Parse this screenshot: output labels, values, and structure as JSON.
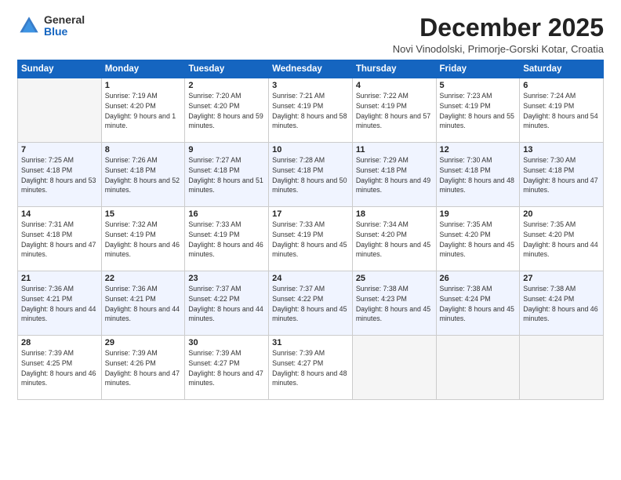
{
  "logo": {
    "general": "General",
    "blue": "Blue"
  },
  "title": "December 2025",
  "subtitle": "Novi Vinodolski, Primorje-Gorski Kotar, Croatia",
  "days": [
    "Sunday",
    "Monday",
    "Tuesday",
    "Wednesday",
    "Thursday",
    "Friday",
    "Saturday"
  ],
  "weeks": [
    [
      {
        "num": "",
        "sunrise": "",
        "sunset": "",
        "daylight": ""
      },
      {
        "num": "1",
        "sunrise": "Sunrise: 7:19 AM",
        "sunset": "Sunset: 4:20 PM",
        "daylight": "Daylight: 9 hours and 1 minute."
      },
      {
        "num": "2",
        "sunrise": "Sunrise: 7:20 AM",
        "sunset": "Sunset: 4:20 PM",
        "daylight": "Daylight: 8 hours and 59 minutes."
      },
      {
        "num": "3",
        "sunrise": "Sunrise: 7:21 AM",
        "sunset": "Sunset: 4:19 PM",
        "daylight": "Daylight: 8 hours and 58 minutes."
      },
      {
        "num": "4",
        "sunrise": "Sunrise: 7:22 AM",
        "sunset": "Sunset: 4:19 PM",
        "daylight": "Daylight: 8 hours and 57 minutes."
      },
      {
        "num": "5",
        "sunrise": "Sunrise: 7:23 AM",
        "sunset": "Sunset: 4:19 PM",
        "daylight": "Daylight: 8 hours and 55 minutes."
      },
      {
        "num": "6",
        "sunrise": "Sunrise: 7:24 AM",
        "sunset": "Sunset: 4:19 PM",
        "daylight": "Daylight: 8 hours and 54 minutes."
      }
    ],
    [
      {
        "num": "7",
        "sunrise": "Sunrise: 7:25 AM",
        "sunset": "Sunset: 4:18 PM",
        "daylight": "Daylight: 8 hours and 53 minutes."
      },
      {
        "num": "8",
        "sunrise": "Sunrise: 7:26 AM",
        "sunset": "Sunset: 4:18 PM",
        "daylight": "Daylight: 8 hours and 52 minutes."
      },
      {
        "num": "9",
        "sunrise": "Sunrise: 7:27 AM",
        "sunset": "Sunset: 4:18 PM",
        "daylight": "Daylight: 8 hours and 51 minutes."
      },
      {
        "num": "10",
        "sunrise": "Sunrise: 7:28 AM",
        "sunset": "Sunset: 4:18 PM",
        "daylight": "Daylight: 8 hours and 50 minutes."
      },
      {
        "num": "11",
        "sunrise": "Sunrise: 7:29 AM",
        "sunset": "Sunset: 4:18 PM",
        "daylight": "Daylight: 8 hours and 49 minutes."
      },
      {
        "num": "12",
        "sunrise": "Sunrise: 7:30 AM",
        "sunset": "Sunset: 4:18 PM",
        "daylight": "Daylight: 8 hours and 48 minutes."
      },
      {
        "num": "13",
        "sunrise": "Sunrise: 7:30 AM",
        "sunset": "Sunset: 4:18 PM",
        "daylight": "Daylight: 8 hours and 47 minutes."
      }
    ],
    [
      {
        "num": "14",
        "sunrise": "Sunrise: 7:31 AM",
        "sunset": "Sunset: 4:18 PM",
        "daylight": "Daylight: 8 hours and 47 minutes."
      },
      {
        "num": "15",
        "sunrise": "Sunrise: 7:32 AM",
        "sunset": "Sunset: 4:19 PM",
        "daylight": "Daylight: 8 hours and 46 minutes."
      },
      {
        "num": "16",
        "sunrise": "Sunrise: 7:33 AM",
        "sunset": "Sunset: 4:19 PM",
        "daylight": "Daylight: 8 hours and 46 minutes."
      },
      {
        "num": "17",
        "sunrise": "Sunrise: 7:33 AM",
        "sunset": "Sunset: 4:19 PM",
        "daylight": "Daylight: 8 hours and 45 minutes."
      },
      {
        "num": "18",
        "sunrise": "Sunrise: 7:34 AM",
        "sunset": "Sunset: 4:20 PM",
        "daylight": "Daylight: 8 hours and 45 minutes."
      },
      {
        "num": "19",
        "sunrise": "Sunrise: 7:35 AM",
        "sunset": "Sunset: 4:20 PM",
        "daylight": "Daylight: 8 hours and 45 minutes."
      },
      {
        "num": "20",
        "sunrise": "Sunrise: 7:35 AM",
        "sunset": "Sunset: 4:20 PM",
        "daylight": "Daylight: 8 hours and 44 minutes."
      }
    ],
    [
      {
        "num": "21",
        "sunrise": "Sunrise: 7:36 AM",
        "sunset": "Sunset: 4:21 PM",
        "daylight": "Daylight: 8 hours and 44 minutes."
      },
      {
        "num": "22",
        "sunrise": "Sunrise: 7:36 AM",
        "sunset": "Sunset: 4:21 PM",
        "daylight": "Daylight: 8 hours and 44 minutes."
      },
      {
        "num": "23",
        "sunrise": "Sunrise: 7:37 AM",
        "sunset": "Sunset: 4:22 PM",
        "daylight": "Daylight: 8 hours and 44 minutes."
      },
      {
        "num": "24",
        "sunrise": "Sunrise: 7:37 AM",
        "sunset": "Sunset: 4:22 PM",
        "daylight": "Daylight: 8 hours and 45 minutes."
      },
      {
        "num": "25",
        "sunrise": "Sunrise: 7:38 AM",
        "sunset": "Sunset: 4:23 PM",
        "daylight": "Daylight: 8 hours and 45 minutes."
      },
      {
        "num": "26",
        "sunrise": "Sunrise: 7:38 AM",
        "sunset": "Sunset: 4:24 PM",
        "daylight": "Daylight: 8 hours and 45 minutes."
      },
      {
        "num": "27",
        "sunrise": "Sunrise: 7:38 AM",
        "sunset": "Sunset: 4:24 PM",
        "daylight": "Daylight: 8 hours and 46 minutes."
      }
    ],
    [
      {
        "num": "28",
        "sunrise": "Sunrise: 7:39 AM",
        "sunset": "Sunset: 4:25 PM",
        "daylight": "Daylight: 8 hours and 46 minutes."
      },
      {
        "num": "29",
        "sunrise": "Sunrise: 7:39 AM",
        "sunset": "Sunset: 4:26 PM",
        "daylight": "Daylight: 8 hours and 47 minutes."
      },
      {
        "num": "30",
        "sunrise": "Sunrise: 7:39 AM",
        "sunset": "Sunset: 4:27 PM",
        "daylight": "Daylight: 8 hours and 47 minutes."
      },
      {
        "num": "31",
        "sunrise": "Sunrise: 7:39 AM",
        "sunset": "Sunset: 4:27 PM",
        "daylight": "Daylight: 8 hours and 48 minutes."
      },
      {
        "num": "",
        "sunrise": "",
        "sunset": "",
        "daylight": ""
      },
      {
        "num": "",
        "sunrise": "",
        "sunset": "",
        "daylight": ""
      },
      {
        "num": "",
        "sunrise": "",
        "sunset": "",
        "daylight": ""
      }
    ]
  ]
}
